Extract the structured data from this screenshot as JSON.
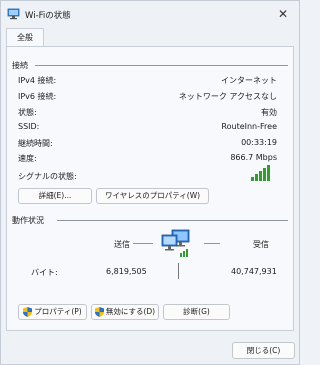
{
  "window": {
    "title": "Wi-Fiの状態",
    "close_glyph": "✕"
  },
  "tab": {
    "label": "全般"
  },
  "connection": {
    "section_title": "接続",
    "rows": [
      {
        "label": "IPv4 接続:",
        "value": "インターネット"
      },
      {
        "label": "IPv6 接続:",
        "value": "ネットワーク アクセスなし"
      },
      {
        "label": "状態:",
        "value": "有効"
      },
      {
        "label": "SSID:",
        "value": "RouteInn-Free"
      },
      {
        "label": "継続時間:",
        "value": "00:33:19"
      },
      {
        "label": "速度:",
        "value": "866.7 Mbps"
      }
    ],
    "signal_label": "シグナルの状態:",
    "signal_bars": 5,
    "details_button": "詳細(E)...",
    "wireless_props_button": "ワイヤレスのプロパティ(W)"
  },
  "activity": {
    "section_title": "動作状況",
    "sent_label": "送信",
    "received_label": "受信",
    "bytes_label": "バイト:",
    "bytes_sent": "6,819,505",
    "bytes_received": "40,747,931"
  },
  "buttons": {
    "properties": "プロパティ(P)",
    "disable": "無効にする(D)",
    "diagnose": "診断(G)",
    "close": "閉じる(C)"
  },
  "colors": {
    "signal_green": "#2f9e2f",
    "accent": "#0067c0"
  }
}
